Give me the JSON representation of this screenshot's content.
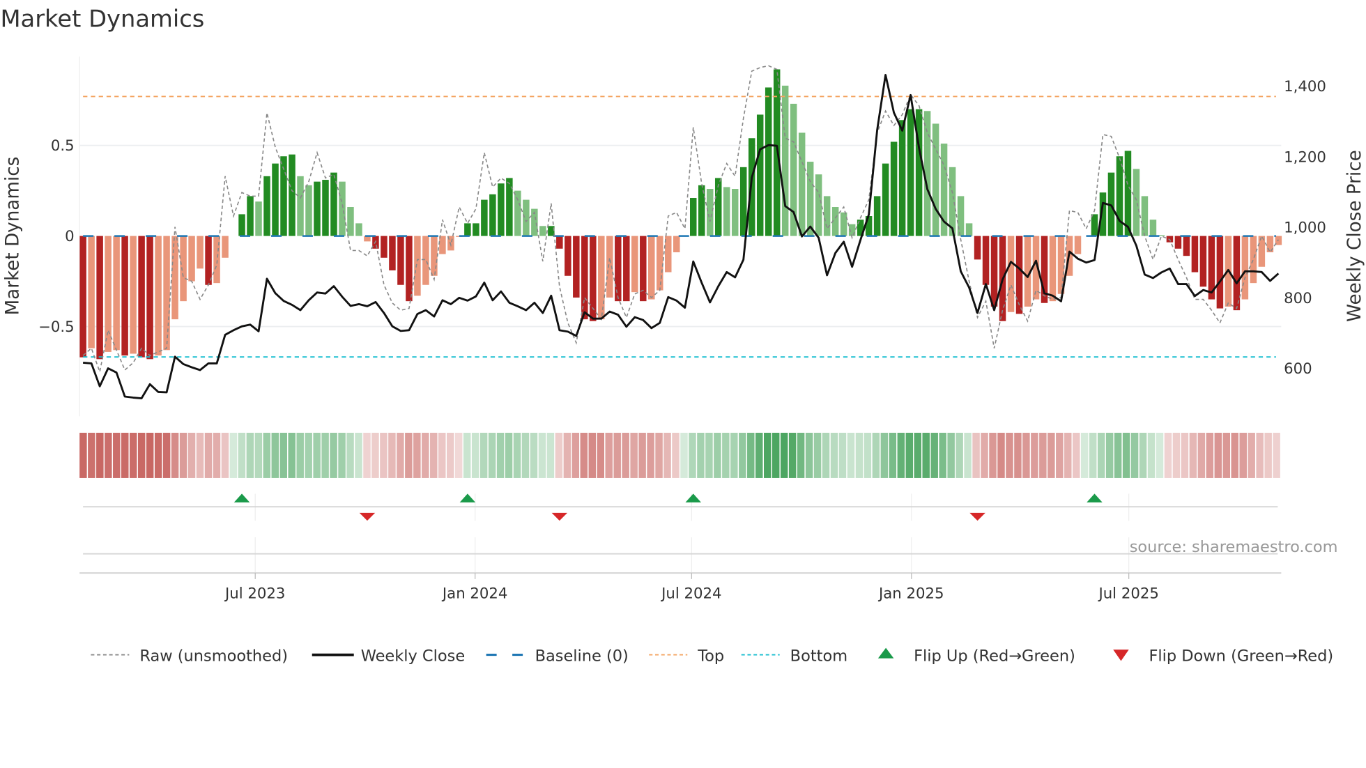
{
  "chart_data": {
    "type": "bar",
    "title": "Market Dynamics",
    "ylabel": "Market Dynamics",
    "y2label": "Weekly Close Price",
    "ylim": [
      -0.99,
      1.0
    ],
    "y2lim": [
      480,
      1500
    ],
    "yticks": [
      {
        "value": 0.5,
        "label": "0.5"
      },
      {
        "value": 0,
        "label": "0"
      },
      {
        "value": -0.5,
        "label": "−0.5"
      }
    ],
    "y2ticks": [
      {
        "value": 1400,
        "label": "1,400"
      },
      {
        "value": 1200,
        "label": "1,200"
      },
      {
        "value": 1000,
        "label": "1,000"
      },
      {
        "value": 800,
        "label": "800"
      },
      {
        "value": 600,
        "label": "600"
      }
    ],
    "xticks": [
      {
        "label": "Jul 2023",
        "week_index": 20.6
      },
      {
        "label": "Jan 2024",
        "week_index": 46.9
      },
      {
        "label": "Jul 2024",
        "week_index": 72.8
      },
      {
        "label": "Jan 2025",
        "week_index": 99.1
      },
      {
        "label": "Jul 2025",
        "week_index": 125.1
      }
    ],
    "top_level": 0.77,
    "bottom_level": -0.668,
    "baseline": 0,
    "values": [
      -0.67,
      -0.62,
      -0.68,
      -0.64,
      -0.63,
      -0.66,
      -0.65,
      -0.67,
      -0.68,
      -0.66,
      -0.63,
      -0.46,
      -0.36,
      -0.25,
      -0.18,
      -0.27,
      -0.26,
      -0.12,
      0.0,
      0.12,
      0.22,
      0.19,
      0.33,
      0.4,
      0.44,
      0.45,
      0.33,
      0.28,
      0.3,
      0.31,
      0.35,
      0.3,
      0.16,
      0.07,
      -0.03,
      -0.07,
      -0.12,
      -0.19,
      -0.27,
      -0.36,
      -0.33,
      -0.27,
      -0.22,
      -0.1,
      -0.08,
      -0.005,
      0.07,
      0.07,
      0.2,
      0.23,
      0.29,
      0.32,
      0.25,
      0.2,
      0.15,
      0.055,
      0.055,
      -0.07,
      -0.22,
      -0.34,
      -0.46,
      -0.47,
      -0.46,
      -0.34,
      -0.36,
      -0.36,
      -0.31,
      -0.36,
      -0.35,
      -0.3,
      -0.2,
      -0.09,
      0.0,
      0.21,
      0.28,
      0.26,
      0.32,
      0.27,
      0.26,
      0.38,
      0.54,
      0.67,
      0.82,
      0.92,
      0.83,
      0.73,
      0.57,
      0.41,
      0.34,
      0.22,
      0.16,
      0.13,
      0.065,
      0.09,
      0.11,
      0.22,
      0.4,
      0.52,
      0.64,
      0.7,
      0.7,
      0.69,
      0.62,
      0.51,
      0.38,
      0.22,
      0.07,
      -0.13,
      -0.27,
      -0.39,
      -0.47,
      -0.42,
      -0.43,
      -0.39,
      -0.35,
      -0.37,
      -0.36,
      -0.32,
      -0.22,
      -0.1,
      0.0,
      0.12,
      0.24,
      0.35,
      0.44,
      0.47,
      0.37,
      0.22,
      0.09,
      0.005,
      -0.035,
      -0.07,
      -0.11,
      -0.2,
      -0.28,
      -0.35,
      -0.4,
      -0.39,
      -0.41,
      -0.35,
      -0.26,
      -0.17,
      -0.09,
      -0.05
    ],
    "raw": [
      -0.66,
      -0.62,
      -0.75,
      -0.52,
      -0.63,
      -0.74,
      -0.7,
      -0.62,
      -0.66,
      -0.64,
      -0.62,
      0.05,
      -0.23,
      -0.25,
      -0.35,
      -0.27,
      -0.16,
      0.33,
      0.11,
      0.24,
      0.22,
      0.22,
      0.68,
      0.49,
      0.37,
      0.25,
      0.21,
      0.3,
      0.46,
      0.32,
      0.34,
      0.18,
      -0.08,
      -0.08,
      -0.11,
      -0.03,
      -0.27,
      -0.37,
      -0.41,
      -0.4,
      -0.13,
      -0.13,
      -0.24,
      0.09,
      -0.05,
      0.16,
      0.07,
      0.15,
      0.46,
      0.27,
      0.32,
      0.29,
      0.2,
      0.08,
      0.13,
      -0.14,
      0.18,
      -0.28,
      -0.48,
      -0.59,
      -0.34,
      -0.4,
      -0.46,
      -0.12,
      -0.34,
      -0.45,
      -0.32,
      -0.3,
      -0.34,
      -0.3,
      0.11,
      0.13,
      0.04,
      0.6,
      0.29,
      0.08,
      0.28,
      0.4,
      0.33,
      0.65,
      0.91,
      0.93,
      0.94,
      0.92,
      0.54,
      0.52,
      0.41,
      0.3,
      0.24,
      0.04,
      0.1,
      0.16,
      -0.01,
      0.1,
      0.2,
      0.57,
      0.69,
      0.61,
      0.67,
      0.78,
      0.72,
      0.57,
      0.48,
      0.39,
      0.24,
      -0.02,
      -0.25,
      -0.45,
      -0.36,
      -0.62,
      -0.41,
      -0.27,
      -0.38,
      -0.47,
      -0.3,
      -0.33,
      -0.35,
      -0.34,
      0.14,
      0.13,
      0.04,
      0.14,
      0.56,
      0.55,
      0.43,
      0.28,
      0.2,
      0.0,
      -0.13,
      0.0,
      -0.02,
      -0.13,
      -0.23,
      -0.35,
      -0.35,
      -0.41,
      -0.48,
      -0.37,
      -0.4,
      -0.23,
      -0.13,
      0.0,
      -0.09,
      -0.02
    ],
    "close": [
      616,
      614,
      549,
      600,
      588,
      520,
      517,
      515,
      555,
      533,
      532,
      633,
      612,
      603,
      595,
      614,
      614,
      695,
      708,
      719,
      724,
      705,
      854,
      813,
      791,
      780,
      765,
      793,
      815,
      812,
      833,
      803,
      777,
      782,
      776,
      788,
      757,
      719,
      706,
      708,
      754,
      765,
      747,
      793,
      782,
      800,
      792,
      804,
      843,
      793,
      818,
      786,
      776,
      765,
      786,
      757,
      806,
      708,
      704,
      692,
      759,
      741,
      741,
      761,
      752,
      718,
      745,
      737,
      714,
      729,
      802,
      792,
      772,
      903,
      843,
      787,
      833,
      873,
      858,
      908,
      1141,
      1221,
      1233,
      1231,
      1060,
      1043,
      974,
      1002,
      970,
      864,
      927,
      959,
      888,
      964,
      1036,
      1276,
      1432,
      1325,
      1274,
      1375,
      1226,
      1108,
      1052,
      1016,
      997,
      875,
      829,
      757,
      839,
      765,
      852,
      902,
      883,
      859,
      905,
      813,
      806,
      790,
      931,
      911,
      900,
      907,
      1069,
      1062,
      1018,
      1001,
      948,
      866,
      856,
      872,
      883,
      839,
      839,
      805,
      822,
      815,
      846,
      879,
      841,
      875,
      875,
      873,
      848,
      869
    ],
    "colors": {
      "strong_red": "#b22222",
      "weak_red": "#e9967a",
      "strong_green": "#228b22",
      "weak_green": "#7fbf7f",
      "close": "#111111",
      "raw": "#888888",
      "baseline": "#1f77b4",
      "top": "#f4a460",
      "bottom": "#17becf",
      "flip_up": "#1a9a4a",
      "flip_down": "#d62728"
    },
    "legend": {
      "position": "bottom",
      "items": [
        {
          "key": "raw",
          "label": "Raw (unsmoothed)"
        },
        {
          "key": "close",
          "label": "Weekly Close"
        },
        {
          "key": "baseline",
          "label": "Baseline (0)"
        },
        {
          "key": "top",
          "label": "Top"
        },
        {
          "key": "bottom",
          "label": "Bottom"
        },
        {
          "key": "flip_up",
          "label": "Flip Up (Red→Green)"
        },
        {
          "key": "flip_down",
          "label": "Flip Down (Green→Red)"
        }
      ]
    },
    "source": "source: sharemaestro.com"
  }
}
